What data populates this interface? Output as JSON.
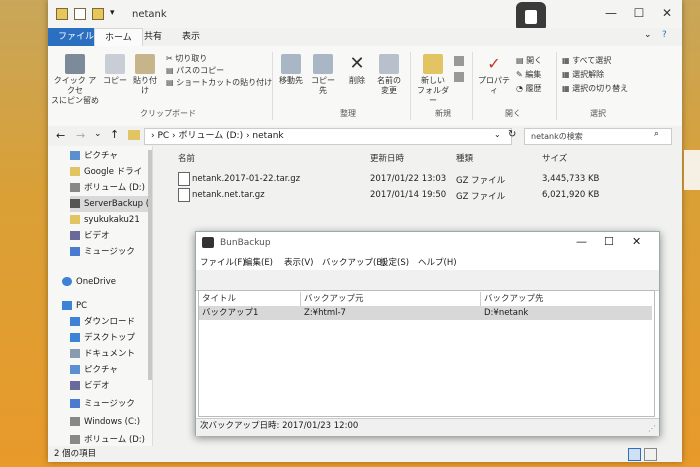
{
  "explorer": {
    "title": "netank",
    "tabs": {
      "file": "ファイル",
      "home": "ホーム",
      "share": "共有",
      "view": "表示"
    },
    "ribbon": {
      "pin": "クイック アクセ\nスにピン留め",
      "copy": "コピー",
      "paste": "貼り付け",
      "cut": "切り取り",
      "copy_path": "パスのコピー",
      "paste_shortcut": "ショートカットの貼り付け",
      "move_to": "移動先",
      "copy_to": "コピー先",
      "delete": "削除",
      "rename": "名前の\n変更",
      "new_folder": "新しい\nフォルダー",
      "properties": "プロパティ",
      "open": "開く",
      "edit": "編集",
      "history": "履歴",
      "select_all": "すべて選択",
      "select_none": "選択解除",
      "invert_select": "選択の切り替え",
      "group_clipboard": "クリップボード",
      "group_organize": "整理",
      "group_new": "新規",
      "group_open": "開く",
      "group_select": "選択"
    },
    "address": {
      "pc": "PC",
      "volume": "ボリューム (D:)",
      "folder": "netank"
    },
    "search_placeholder": "netankの検索",
    "nav": [
      "ピクチャ",
      "Google ドライ",
      "ボリューム (D:)",
      "ServerBackup (¥",
      "syukukaku21",
      "ビデオ",
      "ミュージック",
      "OneDrive",
      "PC",
      "ダウンロード",
      "デスクトップ",
      "ドキュメント",
      "ピクチャ",
      "ビデオ",
      "ミュージック",
      "Windows (C:)",
      "ボリューム (D:)"
    ],
    "columns": {
      "name": "名前",
      "date": "更新日時",
      "type": "種類",
      "size": "サイズ"
    },
    "files": [
      {
        "name": "netank.2017-01-22.tar.gz",
        "date": "2017/01/22 13:03",
        "type": "GZ ファイル",
        "size": "3,445,733 KB"
      },
      {
        "name": "netank.net.tar.gz",
        "date": "2017/01/14 19:50",
        "type": "GZ ファイル",
        "size": "6,021,920 KB"
      }
    ],
    "status": "2 個の項目"
  },
  "bunbackup": {
    "title": "BunBackup",
    "menu": [
      "ファイル(F)",
      "編集(E)",
      "表示(V)",
      "バックアップ(B)",
      "設定(S)",
      "ヘルプ(H)"
    ],
    "columns": {
      "title": "タイトル",
      "source": "バックアップ元",
      "dest": "バックアップ先"
    },
    "rows": [
      {
        "title": "バックアップ1",
        "source": "Z:¥html-7",
        "dest": "D:¥netank"
      }
    ],
    "status": "次バックアップ日時: 2017/01/23 12:00"
  },
  "colors": {
    "accent": "#2a6fc0",
    "desktop": "#e89a2a"
  }
}
